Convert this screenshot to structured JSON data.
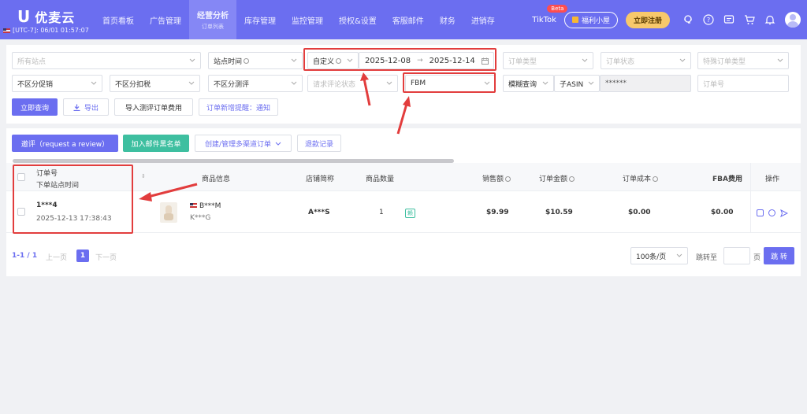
{
  "nav": {
    "logo_mark": "U",
    "logo_text": "优麦云",
    "timezone": "[UTC-7]: 06/01 01:57:07",
    "menu": [
      {
        "label": "首页看板"
      },
      {
        "label": "广告管理"
      },
      {
        "label": "经营分析",
        "sub": "订单列表"
      },
      {
        "label": "库存管理"
      },
      {
        "label": "监控管理"
      },
      {
        "label": "授权&设置"
      },
      {
        "label": "客服邮件"
      },
      {
        "label": "财务"
      },
      {
        "label": "进销存"
      }
    ],
    "tiktok": "TikTok",
    "beta": "Beta",
    "welfare": "福利小屋",
    "register": "立即注册"
  },
  "filters": {
    "all_sites": "所有站点",
    "site_time": "站点时间",
    "date_mode": "自定义",
    "date_start": "2025-12-08",
    "date_sep": "→",
    "date_end": "2025-12-14",
    "order_type": "订单类型",
    "order_status": "订单状态",
    "special_order_type": "特殊订单类型",
    "promo": "不区分促销",
    "tax": "不区分扣税",
    "review_test": "不区分测评",
    "review_status": "请求评论状态",
    "fulfillment": "FBM",
    "fuzzy": "模糊查询",
    "asin_type": "子ASIN",
    "asin_value": "******",
    "order_no": "订单号"
  },
  "actions": {
    "query": "立即查询",
    "export": "导出",
    "import_cost": "导入测评订单费用",
    "notify": "订单新增提醒：通知"
  },
  "toolbar": {
    "request_review": "邀评（request a review）",
    "blacklist": "加入邮件黑名单",
    "multichannel": "创建/管理多渠道订单",
    "refund_log": "退款记录"
  },
  "table": {
    "headers": {
      "order_no": "订单号",
      "order_time": "下单站点时间",
      "product": "商品信息",
      "store": "店铺简称",
      "qty": "商品数量",
      "sales": "销售额",
      "amount": "订单金额",
      "cost": "订单成本",
      "fba_fee": "FBA费用",
      "ops": "操作"
    },
    "rows": [
      {
        "order_no": "1***4",
        "order_time": "2025-12-13 17:38:43",
        "product_name": "B***M",
        "product_sub": "K***G",
        "store": "A***S",
        "qty": "1",
        "tag": "赖",
        "sales": "$9.99",
        "amount": "$10.59",
        "cost": "$0.00",
        "fba_fee": "$0.00"
      }
    ]
  },
  "pager": {
    "range": "1-1 / 1",
    "prev": "上一页",
    "page": "1",
    "next": "下一页",
    "page_size": "100条/页",
    "jump_to": "跳转至",
    "page_unit": "页",
    "go": "跳 转"
  },
  "colors": {
    "nav": "#6b6ef0",
    "primary": "#6b6ef0",
    "green": "#3ebfa0",
    "annotation_red": "#e23d3d"
  }
}
